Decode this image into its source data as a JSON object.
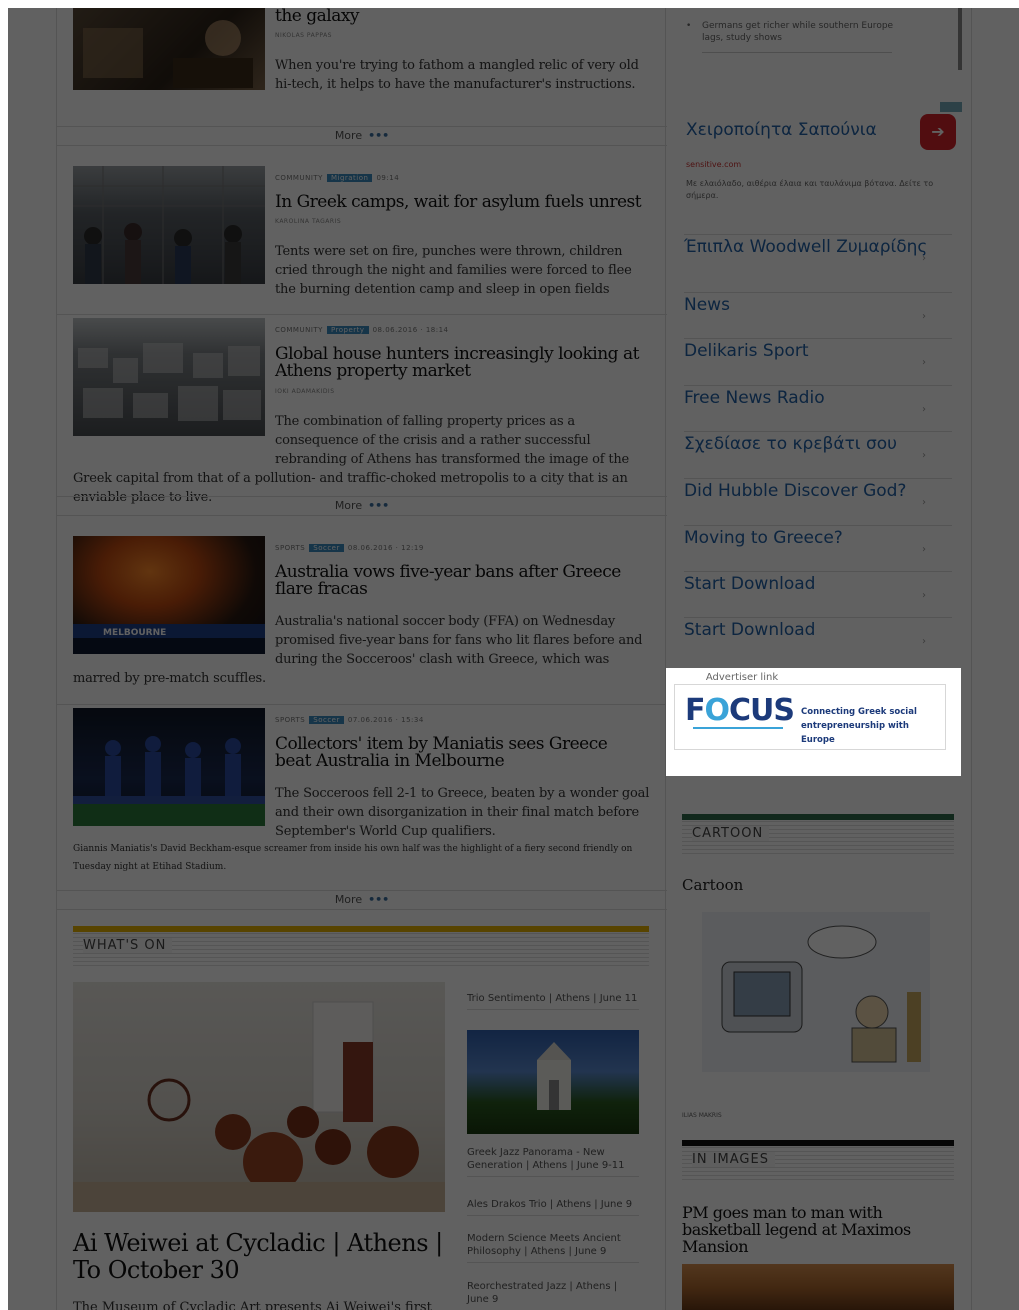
{
  "articles": [
    {
      "headline": "the galaxy",
      "author": "NIKOLAS PAPPAS",
      "excerpt": "When you're trying to fathom a mangled relic of very old hi-tech, it helps to have the manufacturer's instructions."
    },
    {
      "section": "COMMUNITY",
      "badge": "Migration",
      "time": "09:14",
      "headline": "In Greek camps, wait for asylum fuels unrest",
      "author": "KAROLINA TAGARIS",
      "excerpt": "Tents were set on fire, punches were thrown, children cried through the night and families were forced to flee the burning detention camp and sleep in open fields"
    },
    {
      "section": "COMMUNITY",
      "badge": "Property",
      "time": "08.06.2016 · 18:14",
      "headline": "Global house hunters increasingly looking at Athens property market",
      "author": "IOKI ADAMAKIDIS",
      "excerpt": "The combination of falling property prices as a consequence of the crisis and a rather successful rebranding of Athens has transformed the image of the Greek capital from that of a pollution- and traffic-choked metropolis to a city that is an enviable place to live."
    },
    {
      "section": "SPORTS",
      "badge": "Soccer",
      "time": "08.06.2016 · 12:19",
      "headline": "Australia vows five-year bans after Greece flare fracas",
      "author": "",
      "excerpt": "Australia's national soccer body (FFA) on Wednesday promised five-year bans for fans who lit flares before and during the Socceroos' clash with Greece, which was marred by pre-match scuffles."
    },
    {
      "section": "SPORTS",
      "badge": "Soccer",
      "time": "07.06.2016 · 15:34",
      "headline": "Collectors' item by Maniatis sees Greece beat Australia in Melbourne",
      "author": "",
      "excerpt": "The Socceroos fell 2-1 to Greece, beaten by a wonder goal and their own disorganization in their final match before September's World Cup qualifiers.",
      "caption": "Giannis Maniatis's David Beckham-esque screamer from inside his own half was the highlight of a fiery second friendly on Tuesday night at Etihad Stadium."
    }
  ],
  "more_label": "More",
  "more_dots": "•••",
  "whats_on": {
    "label": "WHAT'S ON",
    "feature_title": "Ai Weiwei at Cycladic | Athens | To October 30",
    "feature_excerpt": "The Museum of Cycladic Art presents Ai Weiwei's first",
    "events": [
      "Trio Sentimento | Athens | June 11",
      "Greek Jazz Panorama - New Generation | Athens | June 9-11",
      "Ales Drakos Trio | Athens | June 9",
      "Modern Science Meets Ancient Philosophy | Athens | June 9",
      "Reorchestrated Jazz | Athens | June 9"
    ]
  },
  "sidebar": {
    "bullet_item": "Germans get richer while southern Europe lags, study shows",
    "ad": {
      "title": "Χειροποίητα Σαπούνια",
      "button_icon": "arrow-right-icon",
      "site": "sensitive.com",
      "description": "Με ελαιόλαδο, αιθέρια έλαια και ταυλάνιμα βότανα. Δείτε το σήμερα.",
      "links": [
        "Έπιπλα Woodwell Ζυμαρίδης",
        "News",
        "Delikaris Sport",
        "Free News Radio",
        "Σχεδίασε το κρεβάτι σου",
        "Did Hubble Discover God?",
        "Moving to Greece?",
        "Start Download",
        "Start Download"
      ]
    },
    "focus": {
      "advertiser_label": "Advertiser link",
      "logo_text_1": "F",
      "logo_text_o": "O",
      "logo_text_2": "CUS",
      "tagline": "Connecting Greek social entrepreneurship with Europe"
    },
    "cartoon": {
      "label": "CARTOON",
      "caption": "Cartoon",
      "author": "ILIAS MAKRIS"
    },
    "in_images": {
      "label": "IN IMAGES",
      "headline": "PM goes man to man with basketball legend at Maximos Mansion"
    }
  },
  "colors": {
    "badge": "#3a8cc1",
    "whatson_bar": "#e8b400",
    "cartoon_bar": "#2f6b4a",
    "inimages_bar": "#111111",
    "ad_link": "#2263a8",
    "ad_button": "#d6232b"
  }
}
